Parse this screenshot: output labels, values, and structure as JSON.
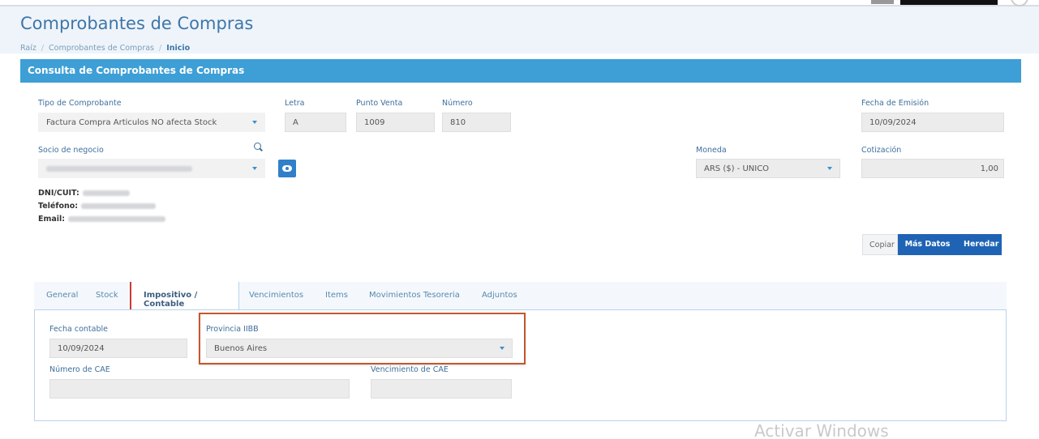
{
  "page": {
    "title": "Comprobantes de Compras",
    "breadcrumb": [
      "Raíz",
      "Comprobantes de Compras",
      "Inicio"
    ]
  },
  "panel": {
    "title": "Consulta de Comprobantes de Compras"
  },
  "form": {
    "tipo_label": "Tipo de Comprobante",
    "tipo_value": "Factura Compra Articulos NO afecta Stock",
    "letra_label": "Letra",
    "letra_value": "A",
    "punto_label": "Punto Venta",
    "punto_value": "1009",
    "numero_label": "Número",
    "numero_value": "810",
    "fecha_emision_label": "Fecha de Emisión",
    "fecha_emision_value": "10/09/2024",
    "socio_label": "Socio de negocio",
    "moneda_label": "Moneda",
    "moneda_value": "ARS ($) - UNICO",
    "cotizacion_label": "Cotización",
    "cotizacion_value": "1,00",
    "dni_label": "DNI/CUIT:",
    "telefono_label": "Teléfono:",
    "email_label": "Email:"
  },
  "actions": {
    "copiar": "Copiar",
    "mas_datos": "Más Datos",
    "heredar": "Heredar"
  },
  "tabs": [
    {
      "label": "General"
    },
    {
      "label": "Stock"
    },
    {
      "label": "Impositivo / Contable"
    },
    {
      "label": "Vencimientos"
    },
    {
      "label": "Items"
    },
    {
      "label": "Movimientos Tesoreria"
    },
    {
      "label": "Adjuntos"
    }
  ],
  "tab_content": {
    "fecha_contable_label": "Fecha contable",
    "fecha_contable_value": "10/09/2024",
    "provincia_label": "Provincia IIBB",
    "provincia_value": "Buenos Aires",
    "cae_label": "Número de CAE",
    "venc_cae_label": "Vencimiento de CAE"
  },
  "watermark": "Activar Windows",
  "colors": {
    "accent": "#3d9fd6",
    "primary_button": "#1f63b4",
    "highlight": "#c4572e"
  }
}
